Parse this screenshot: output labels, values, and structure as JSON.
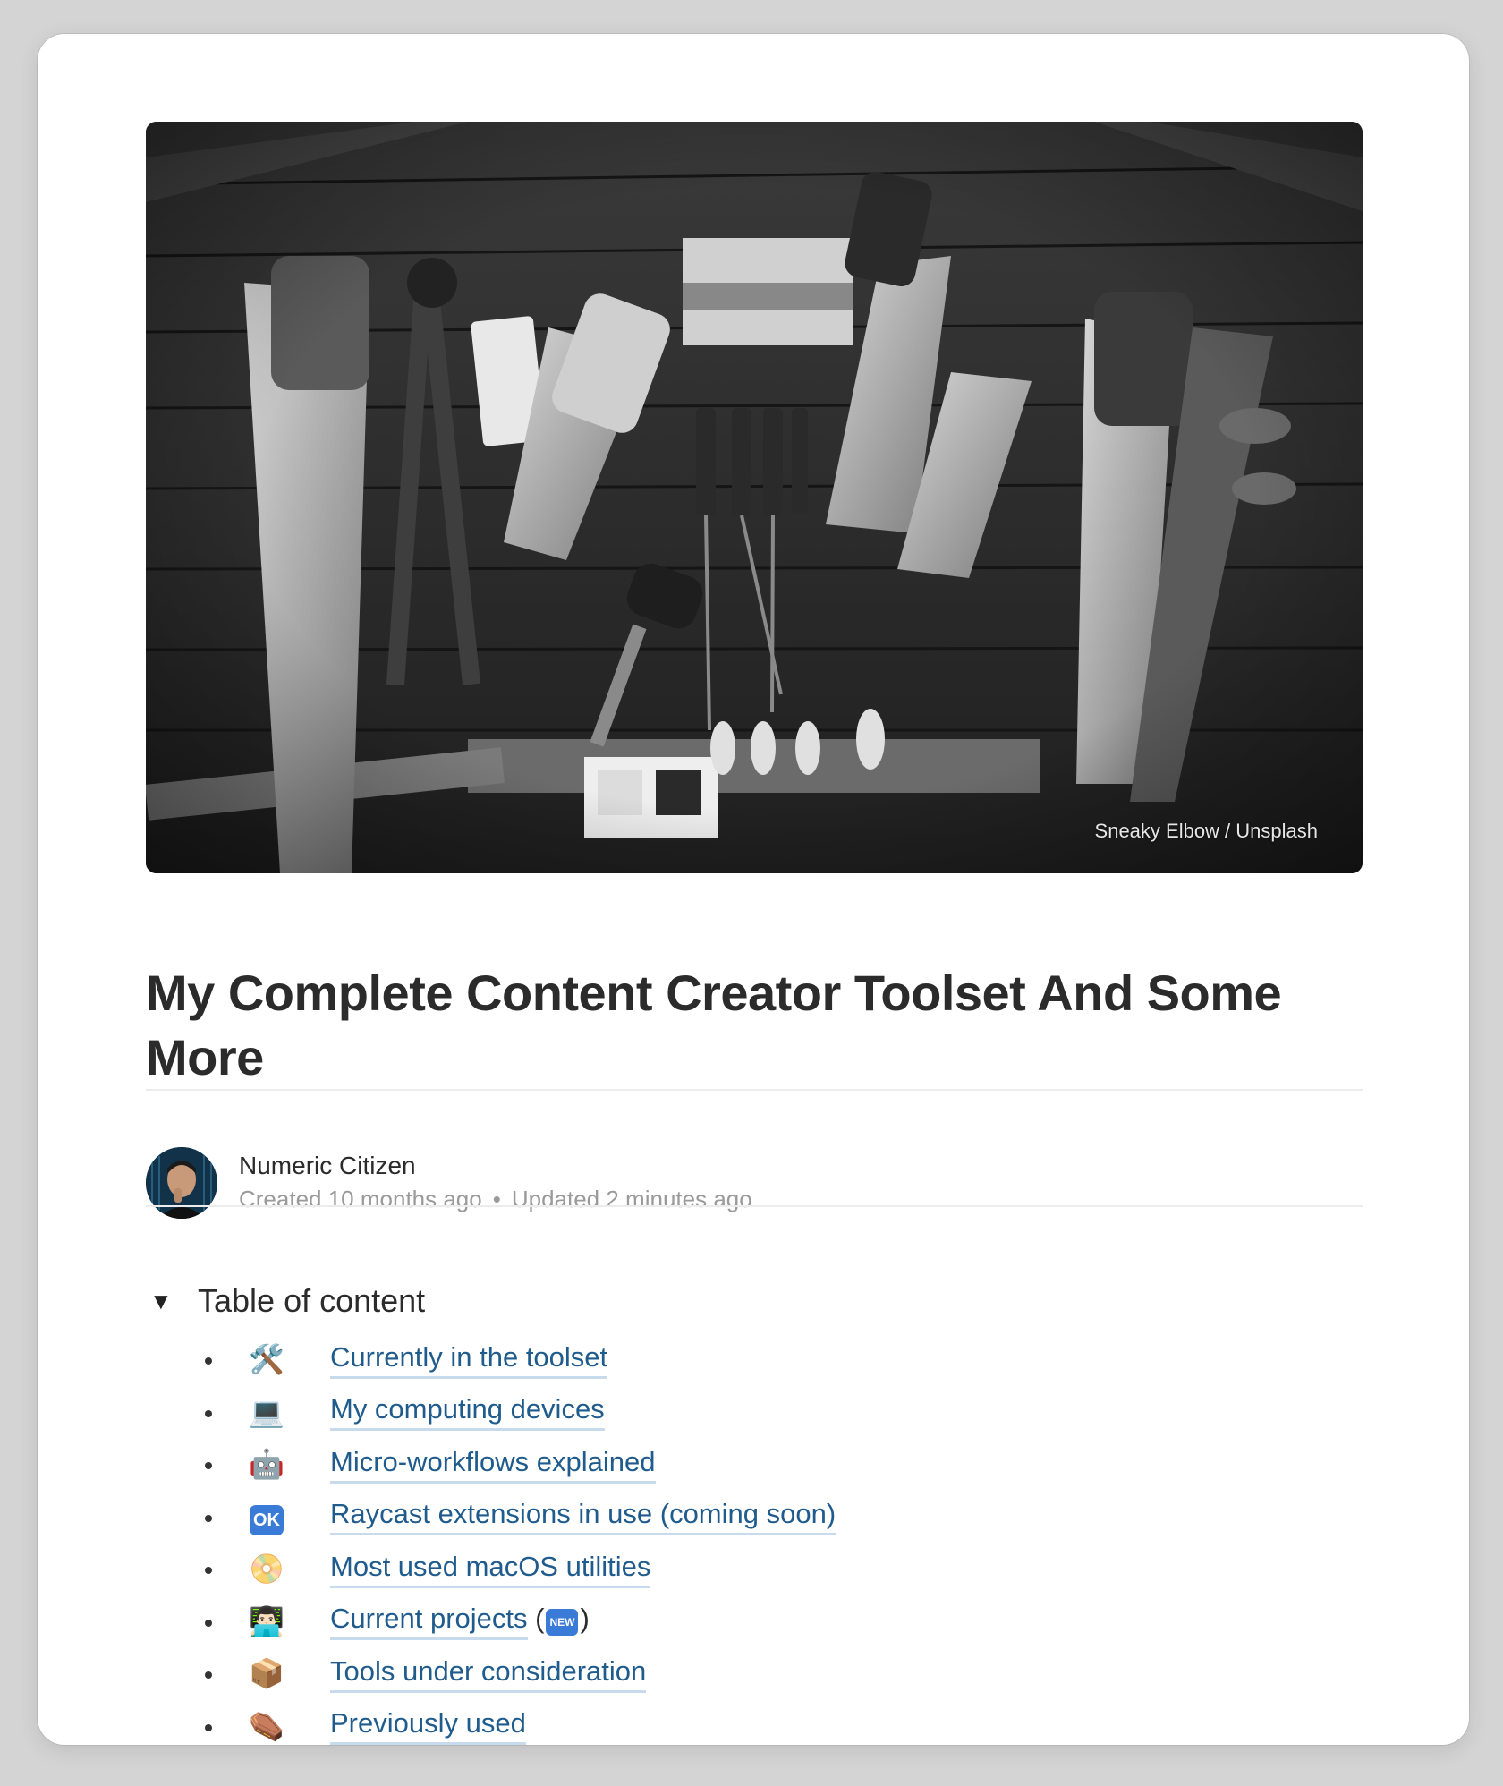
{
  "cover": {
    "credit": "Sneaky Elbow / Unsplash",
    "image_alt": "tools-on-wall-photo"
  },
  "article": {
    "title": "My Complete Content Creator Toolset And Some More"
  },
  "author": {
    "name": "Numeric Citizen",
    "created": "Created 10 months ago",
    "separator": "•",
    "updated": "Updated 2 minutes ago"
  },
  "toc": {
    "toggle_glyph": "▼",
    "title": "Table of content",
    "items": [
      {
        "emoji": "🛠️",
        "label": "Currently in the toolset"
      },
      {
        "emoji": "💻",
        "label": "My computing devices"
      },
      {
        "emoji": "🤖",
        "label": "Micro-workflows explained"
      },
      {
        "emoji": "OK",
        "label": "Raycast extensions in use (coming soon)"
      },
      {
        "emoji": "📀",
        "label": "Most used macOS utilities"
      },
      {
        "emoji": "👨🏻‍💻",
        "label": "Current projects",
        "suffix_open": " (",
        "badge": "NEW",
        "suffix_close": ")"
      },
      {
        "emoji": "📦",
        "label": "Tools under consideration"
      },
      {
        "emoji": "⚰️",
        "label": "Previously used"
      }
    ]
  },
  "colors": {
    "link": "#1f5b8c",
    "link_underline": "#c8dbec",
    "title_text": "#2b2b2b",
    "meta_text": "#9a9a9a",
    "badge_blue": "#3b7bd8"
  }
}
